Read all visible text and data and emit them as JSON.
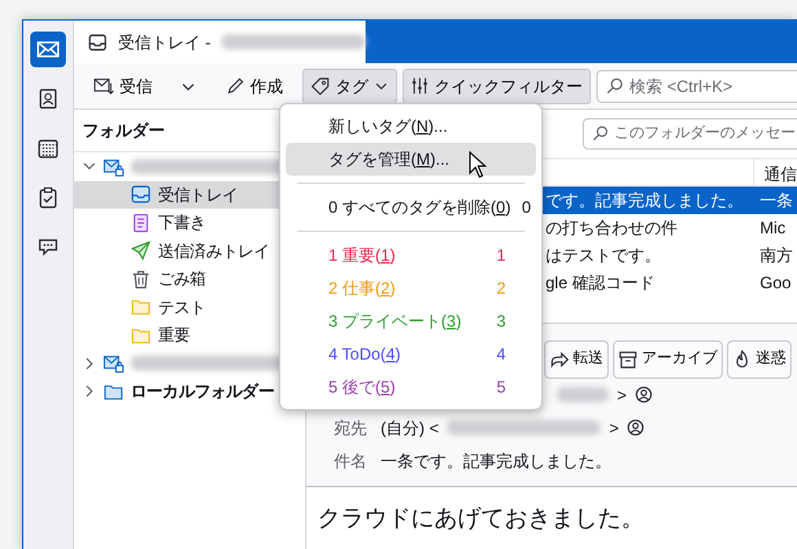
{
  "spaces": [
    {
      "kind": "mail",
      "selected": true
    },
    {
      "kind": "contacts",
      "selected": false
    },
    {
      "kind": "calendar",
      "selected": false
    },
    {
      "kind": "tasks",
      "selected": false
    },
    {
      "kind": "chat",
      "selected": false
    }
  ],
  "tab": {
    "title": "受信トレイ -"
  },
  "toolbar": {
    "get_mail": "受信",
    "write": "作成",
    "tag": "タグ",
    "quick_filter": "クイックフィルター",
    "search": {
      "placeholder": "検索 <Ctrl+K>"
    }
  },
  "folder_pane": {
    "title": "フォルダー",
    "tree": [
      {
        "kind": "account",
        "expanded": true,
        "selected": false,
        "children": [
          {
            "kind": "inbox",
            "label": "受信トレイ",
            "selected": true
          },
          {
            "kind": "drafts",
            "label": "下書き",
            "selected": false
          },
          {
            "kind": "sent",
            "label": "送信済みトレイ",
            "selected": false
          },
          {
            "kind": "trash",
            "label": "ごみ箱",
            "selected": false
          },
          {
            "kind": "folder",
            "label": "テスト",
            "selected": false
          },
          {
            "kind": "folder",
            "label": "重要",
            "selected": false
          }
        ]
      },
      {
        "kind": "account",
        "expanded": false,
        "selected": false
      },
      {
        "kind": "local",
        "label": "ローカルフォルダー",
        "expanded": false,
        "selected": false
      }
    ]
  },
  "message_list": {
    "filter": {
      "placeholder": "このフォルダーのメッセー"
    },
    "columns": [
      "通信"
    ],
    "rows": [
      {
        "subject": "です。記事完成しました。",
        "sender": "一条",
        "selected": true
      },
      {
        "subject": "の打ち合わせの件",
        "sender": "Mic",
        "selected": false
      },
      {
        "subject": "はテストです。",
        "sender": "南方",
        "selected": false
      },
      {
        "subject": "gle 確認コード",
        "sender": "Goo",
        "selected": false
      }
    ]
  },
  "message": {
    "buttons": [
      {
        "kind": "forward",
        "label": "転送"
      },
      {
        "kind": "archive",
        "label": "アーカイブ"
      },
      {
        "kind": "junk",
        "label": "迷惑"
      }
    ],
    "from": {
      "address_end": ">"
    },
    "to": {
      "label": "宛先",
      "value": "(自分) <",
      "address_end": ">"
    },
    "subject": {
      "label": "件名",
      "value": "一条です。記事完成しました。"
    },
    "body": "クラウドにあげておきました。"
  },
  "tag_menu": [
    {
      "kind": "item",
      "before": "新しいタグ(",
      "key": "N",
      "after": ")...",
      "hover": false
    },
    {
      "kind": "item",
      "before": "タグを管理(",
      "key": "M",
      "after": ")...",
      "hover": true
    },
    {
      "kind": "separator"
    },
    {
      "kind": "item",
      "before": "0 すべてのタグを削除(",
      "key": "0",
      "after": ")",
      "shortcut": "0",
      "hover": false
    },
    {
      "kind": "separator"
    },
    {
      "kind": "tag",
      "before": "1 重要(",
      "key": "1",
      "after": ")",
      "shortcut": "1",
      "color": "#e8294a",
      "hover": false
    },
    {
      "kind": "tag",
      "before": "2 仕事(",
      "key": "2",
      "after": ")",
      "shortcut": "2",
      "color": "#f29a0e",
      "hover": false
    },
    {
      "kind": "tag",
      "before": "3 プライベート(",
      "key": "3",
      "after": ")",
      "shortcut": "3",
      "color": "#2f9e2f",
      "hover": false
    },
    {
      "kind": "tag",
      "before": "4 ToDo(",
      "key": "4",
      "after": ")",
      "shortcut": "4",
      "color": "#4d4dff",
      "hover": false
    },
    {
      "kind": "tag",
      "before": "5 後で(",
      "key": "5",
      "after": ")",
      "shortcut": "5",
      "color": "#9b3fae",
      "hover": false
    }
  ]
}
